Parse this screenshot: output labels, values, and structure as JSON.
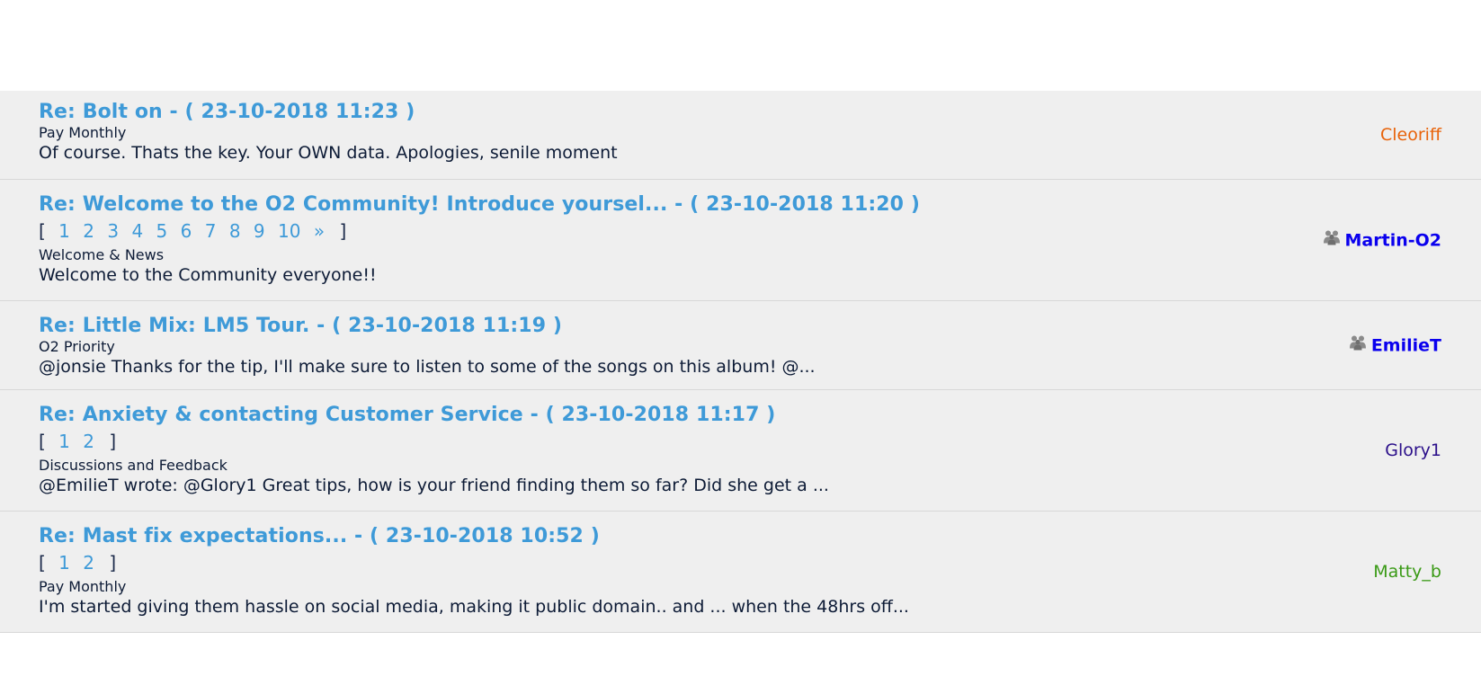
{
  "posts": [
    {
      "title": "Re: Bolt on - ( 23-10-2018 11:23 )",
      "board": "Pay Monthly",
      "snippet": "Of course. Thats the key. Your OWN data. Apologies, senile moment",
      "author": "Cleoriff",
      "author_color": "#e8630a",
      "author_staff": false,
      "pages": []
    },
    {
      "title": "Re: Welcome to the O2 Community! Introduce yoursel... - ( 23-10-2018 11:20 )",
      "board": "Welcome & News",
      "snippet": "Welcome to the Community everyone!!",
      "author": "Martin-O2",
      "author_color": "#0a00ee",
      "author_staff": true,
      "pages": [
        "1",
        "2",
        "3",
        "4",
        "5",
        "6",
        "7",
        "8",
        "9",
        "10",
        "»"
      ]
    },
    {
      "title": "Re: Little Mix: LM5 Tour. - ( 23-10-2018 11:19 )",
      "board": "O2 Priority",
      "snippet": "@jonsie Thanks for the tip, I'll make sure to listen to some of the songs on this album!    @...",
      "author": "EmilieT",
      "author_color": "#0a00ee",
      "author_staff": true,
      "pages": []
    },
    {
      "title": "Re: Anxiety & contacting Customer Service - ( 23-10-2018 11:17 )",
      "board": "Discussions and Feedback",
      "snippet": "@EmilieT wrote:     @Glory1 Great tips, how is your friend finding them so far? Did she get a ...",
      "author": "Glory1",
      "author_color": "#2b0f8a",
      "author_staff": false,
      "pages": [
        "1",
        "2"
      ]
    },
    {
      "title": "Re: Mast fix expectations... - ( 23-10-2018 10:52 )",
      "board": "Pay Monthly",
      "snippet": "I'm started giving them hassle on social media, making it public domain.. and ... when the 48hrs off...",
      "author": "Matty_b",
      "author_color": "#3a9a16",
      "author_staff": false,
      "pages": [
        "1",
        "2"
      ]
    }
  ],
  "pager": {
    "open": "[",
    "close": "]"
  },
  "icons": {
    "staff": "team-icon"
  }
}
